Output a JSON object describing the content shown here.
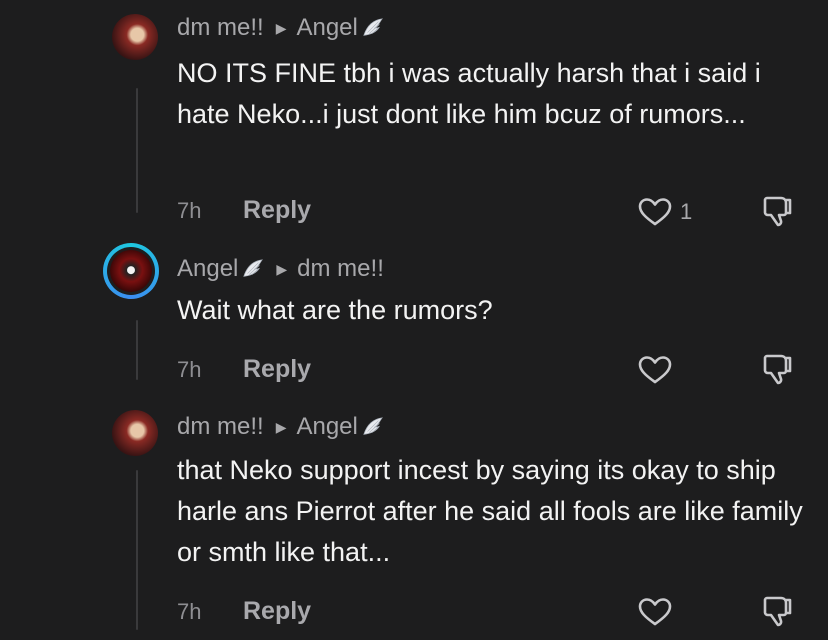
{
  "comments": [
    {
      "author": "dm me!!",
      "reply_to": "Angel",
      "text": "NO ITS FINE tbh i was actually harsh that i said i hate Neko...i just dont like him bcuz of rumors...",
      "time": "7h",
      "reply_label": "Reply",
      "likes": "1"
    },
    {
      "author": "Angel",
      "reply_to": "dm me!!",
      "text": "Wait what are the rumors?",
      "time": "7h",
      "reply_label": "Reply",
      "likes": ""
    },
    {
      "author": "dm me!!",
      "reply_to": "Angel",
      "text": "that Neko support incest by saying its okay to ship harle ans Pierrot after he said all fools are like family or smth like that...",
      "time": "7h",
      "reply_label": "Reply",
      "likes": ""
    }
  ],
  "colors": {
    "background": "#1d1d1e",
    "avatar_ring": "#1ec8e0"
  },
  "icons": [
    "reply-arrow-icon",
    "angel-wing-icon",
    "heart-icon",
    "dislike-icon"
  ]
}
